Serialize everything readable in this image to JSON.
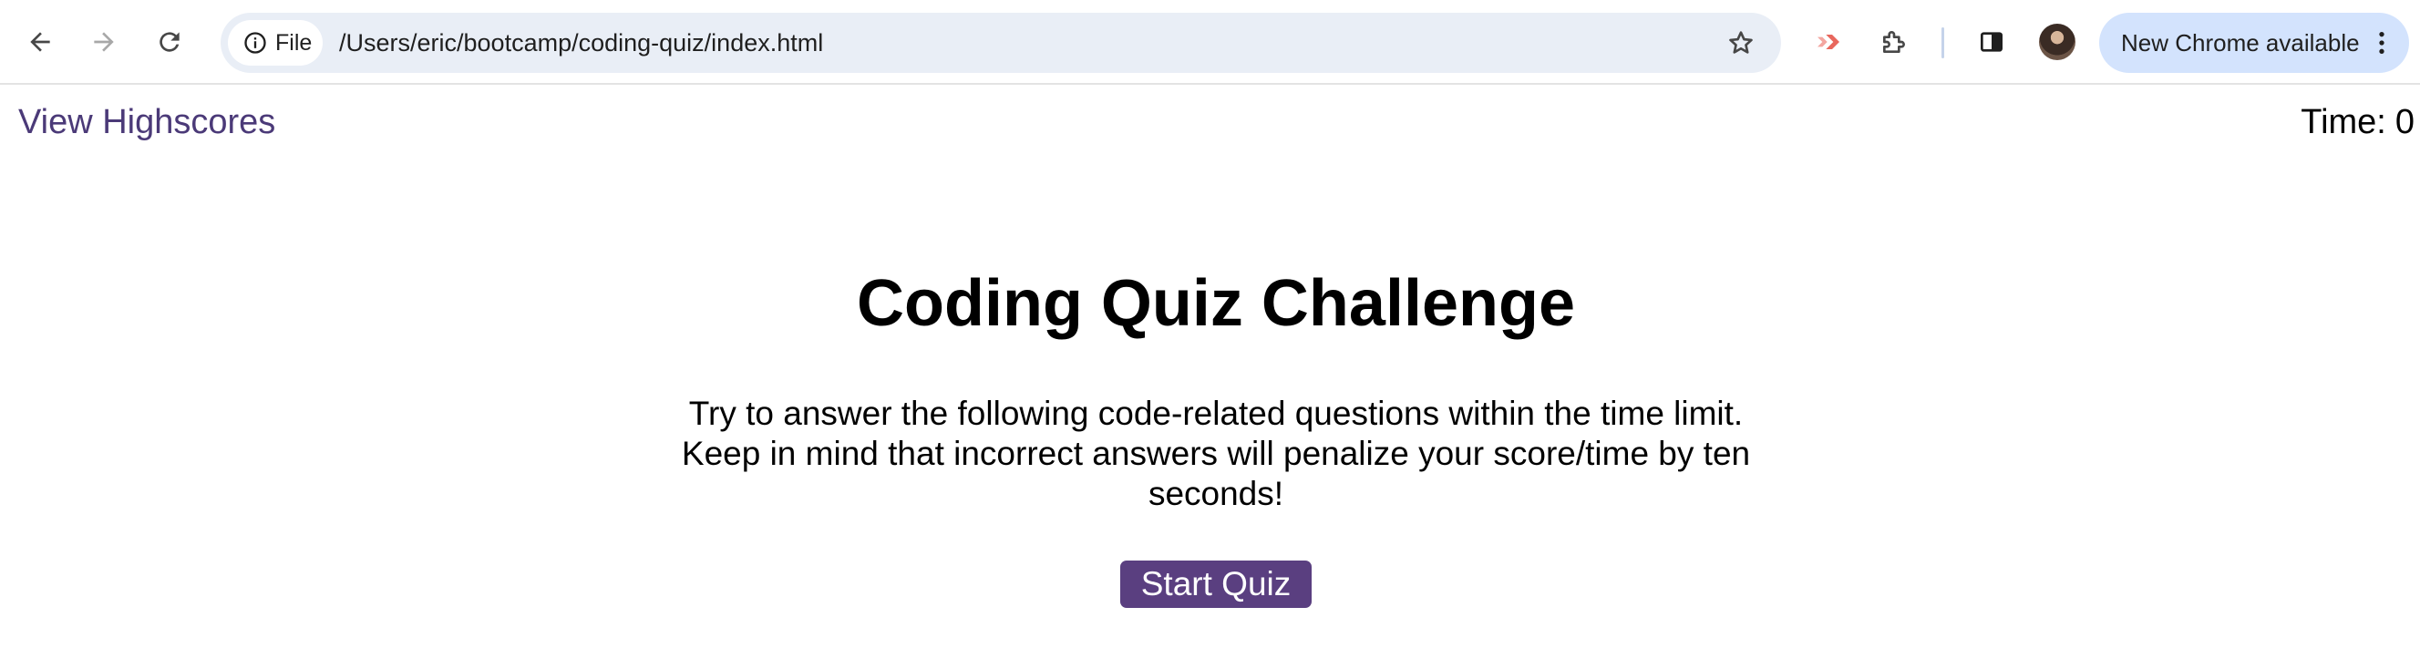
{
  "browser": {
    "omnibox": {
      "chip_label": "File",
      "url": "/Users/eric/bootcamp/coding-quiz/index.html"
    },
    "update_pill_label": "New Chrome available"
  },
  "page": {
    "highscores_link": "View Highscores",
    "timer_label": "Time:",
    "timer_value": "0",
    "title": "Coding Quiz Challenge",
    "description": "Try to answer the following code-related questions within the time limit. Keep in mind that incorrect answers will penalize your score/time by ten seconds!",
    "start_button": "Start Quiz"
  },
  "colors": {
    "accent": "#5a3f80",
    "link": "#4b3a78",
    "omnibox_bg": "#e9eef6",
    "update_pill_bg": "#d3e3fd"
  },
  "icons": [
    "back-arrow-icon",
    "forward-arrow-icon",
    "reload-icon",
    "info-icon",
    "star-icon",
    "extension-arrow-icon",
    "puzzle-icon",
    "side-panel-icon",
    "kebab-menu-icon"
  ]
}
